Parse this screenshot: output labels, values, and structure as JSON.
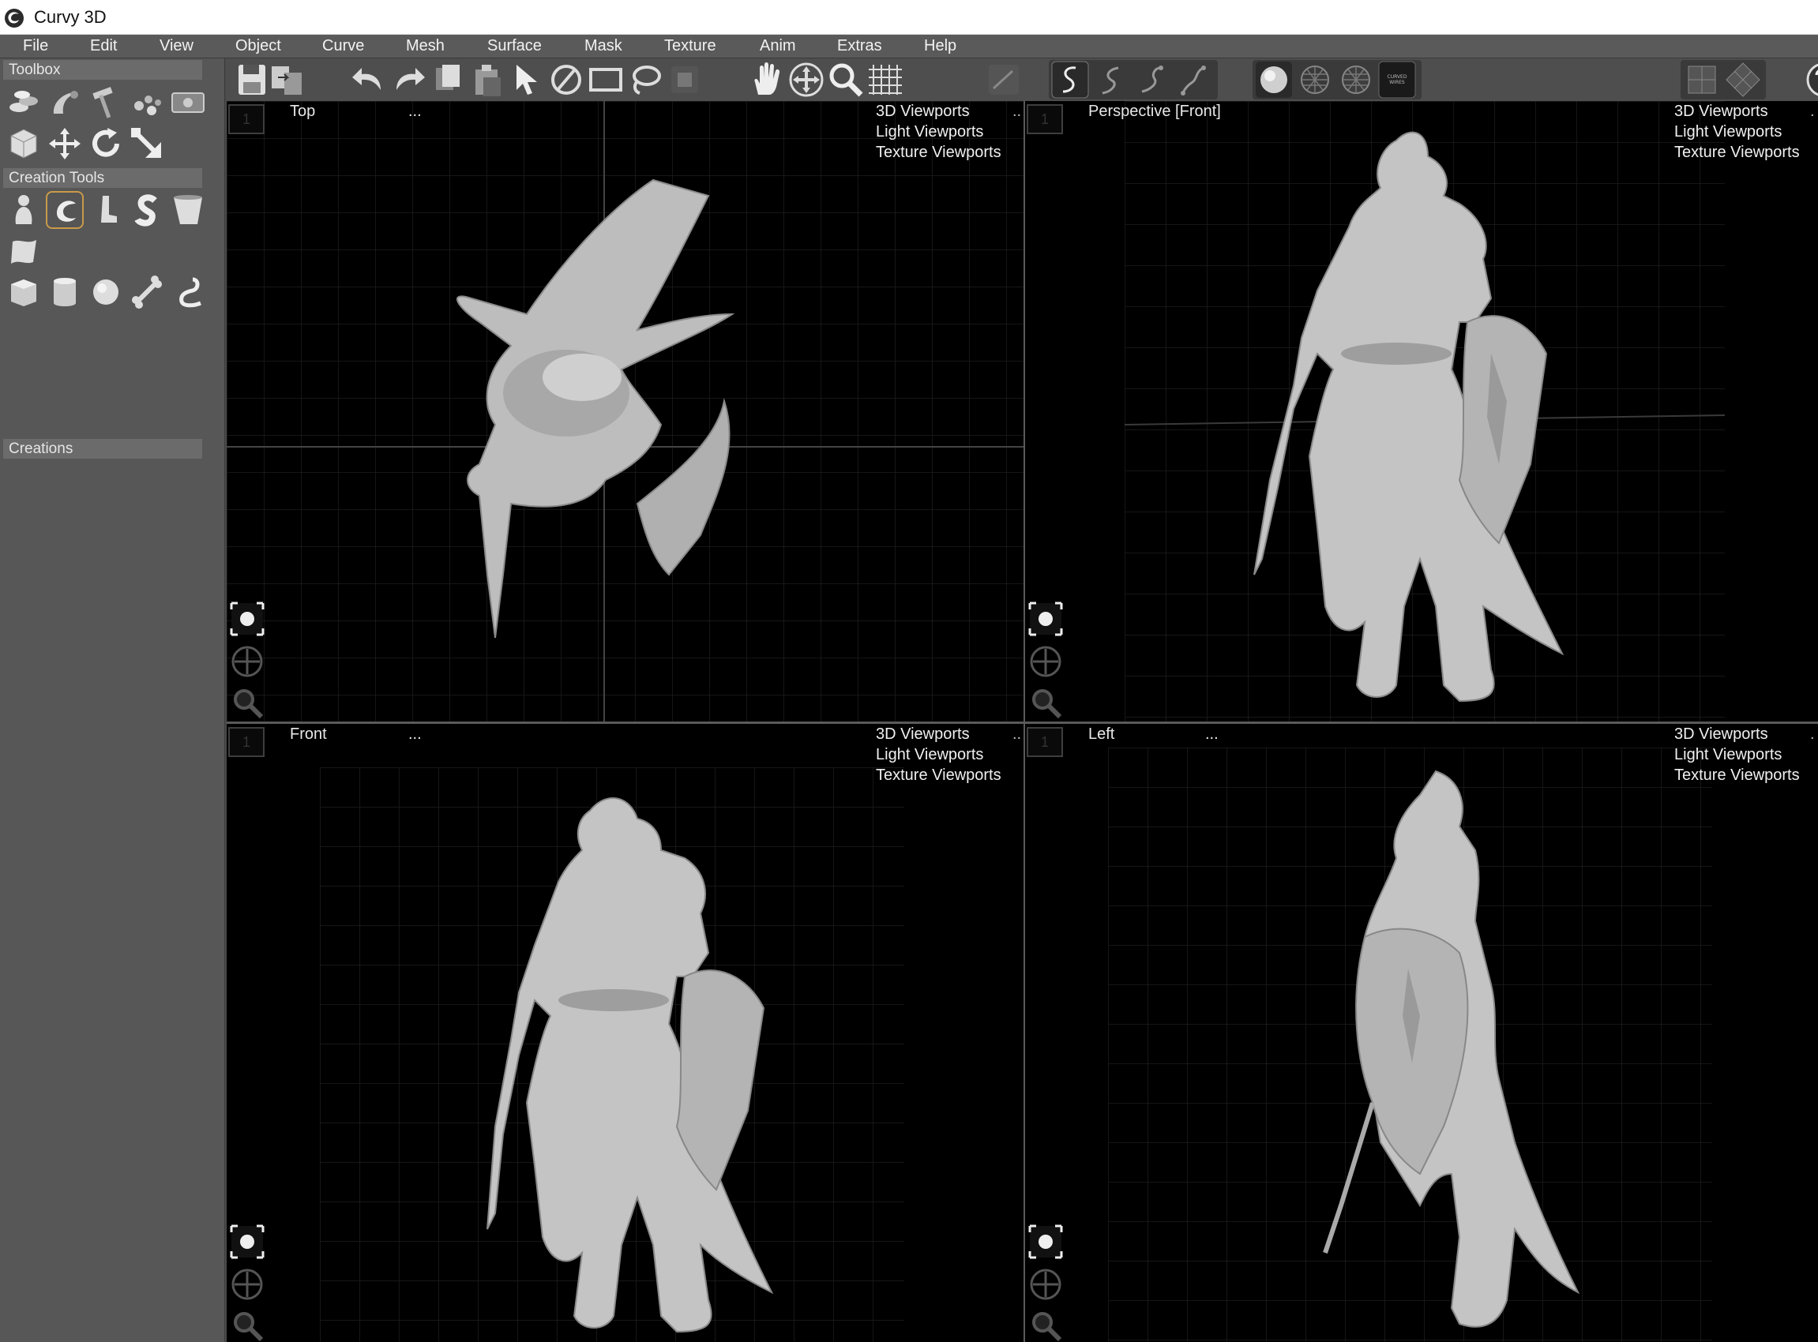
{
  "window": {
    "title": "Curvy 3D",
    "icon": "curvy-swirl-icon"
  },
  "menu": [
    "File",
    "Edit",
    "View",
    "Object",
    "Curve",
    "Mesh",
    "Surface",
    "Mask",
    "Texture",
    "Anim",
    "Extras",
    "Help"
  ],
  "sidebar": {
    "toolbox_label": "Toolbox",
    "creation_tools_label": "Creation Tools",
    "creations_label": "Creations",
    "toolbox_icons": [
      "layers-icon",
      "lathe-icon",
      "hammer-icon",
      "scatter-icon",
      "render-icon",
      "box-select-icon",
      "move-icon",
      "rotate-icon",
      "scale-icon"
    ],
    "creation_icons": [
      "figure-icon",
      "curl-icon",
      "boot-icon",
      "s-shape-icon",
      "cup-icon",
      "cloth-icon",
      "cube-icon",
      "cylinder-icon",
      "sphere-icon",
      "bone-icon",
      "hook-icon"
    ]
  },
  "toolbar": {
    "buttons": [
      "save-icon",
      "import-icon",
      "undo-icon",
      "redo-icon",
      "copy-icon",
      "paste-icon",
      "select-arrow-icon",
      "deselect-icon",
      "rectangle-select-icon",
      "lasso-select-icon",
      "clear-select-icon",
      "pan-hand-icon",
      "move-view-icon",
      "zoom-icon",
      "grid-icon",
      "edit-curve-icon",
      "curve-mode-1-icon",
      "curve-mode-2-icon",
      "curve-mode-3-icon",
      "curve-mode-4-icon",
      "shaded-icon",
      "wireframe-icon",
      "wire-shaded-icon",
      "curved-wires-icon",
      "flat-view-icon",
      "diamond-view-icon",
      "help-icon"
    ],
    "curved_wires_text": "CURVED WIRES"
  },
  "viewports": [
    {
      "name": "Top",
      "dots": "...",
      "number": "1",
      "links": [
        "3D Viewports",
        "Light Viewports",
        "Texture Viewports"
      ],
      "trail": ".."
    },
    {
      "name": "Perspective [Front]",
      "dots": "",
      "number": "1",
      "links": [
        "3D Viewports",
        "Light Viewports",
        "Texture Viewports"
      ],
      "trail": "."
    },
    {
      "name": "Front",
      "dots": "...",
      "number": "1",
      "links": [
        "3D Viewports",
        "Light Viewports",
        "Texture Viewports"
      ],
      "trail": ".."
    },
    {
      "name": "Left",
      "dots": "...",
      "number": "1",
      "links": [
        "3D Viewports",
        "Light Viewports",
        "Texture Viewports"
      ],
      "trail": "."
    }
  ],
  "viewport_controls": [
    "target-icon",
    "orbit-icon",
    "zoom-viewport-icon"
  ]
}
